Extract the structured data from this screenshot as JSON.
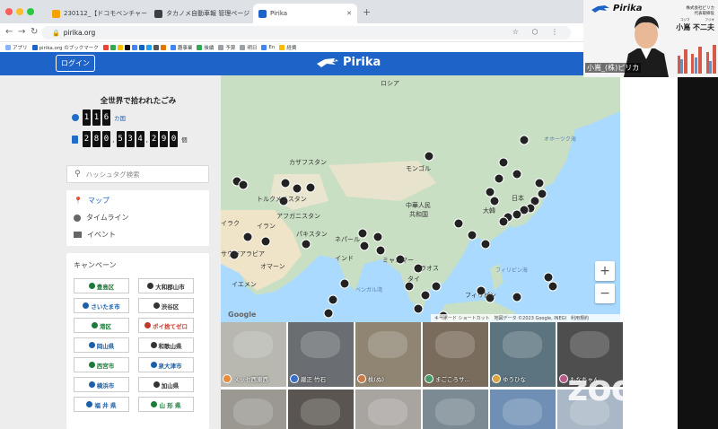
{
  "browser": {
    "tabs": [
      {
        "title": "230112_【ドコモベンチャーズピ",
        "color": "#f4a300"
      },
      {
        "title": "タカノメ自動車報 管理ページ",
        "color": "#3c4043"
      },
      {
        "title": "Pirika",
        "color": "#1e63c8"
      }
    ],
    "url": "pirika.org",
    "bookmarks": [
      "アプリ",
      "pirika.org のブックマーク",
      "趣事業",
      "後續",
      "予算",
      "明日",
      "En",
      "経費",
      "前回"
    ]
  },
  "header": {
    "login_label": "ログイン",
    "logo_text": "Pirika"
  },
  "stats": {
    "title": "全世界で拾われたごみ",
    "countries_digits": [
      "1",
      "1",
      "6"
    ],
    "countries_unit": "カ国",
    "trash_groups": [
      [
        "2",
        "8",
        "0"
      ],
      [
        "5",
        "3",
        "4"
      ],
      [
        "2",
        "9",
        "0"
      ]
    ],
    "trash_unit": "個"
  },
  "search": {
    "placeholder": "ハッシュタグ検索"
  },
  "nav": {
    "map": "マップ",
    "timeline": "タイムライン",
    "event": "イベント"
  },
  "campaign": {
    "title": "キャンペーン",
    "logos": [
      {
        "text": "豊島区",
        "color": "#1b7a3a"
      },
      {
        "text": "大和郡山市",
        "color": "#333"
      },
      {
        "text": "さいたま市",
        "color": "#1b5fa8"
      },
      {
        "text": "渋谷区",
        "color": "#333"
      },
      {
        "text": "港区",
        "color": "#1b7a3a"
      },
      {
        "text": "ポイ捨てゼロ",
        "color": "#c0392b"
      },
      {
        "text": "岡山県",
        "color": "#1b5fa8"
      },
      {
        "text": "和歌山県",
        "color": "#333"
      },
      {
        "text": "西宮市",
        "color": "#1b7a3a"
      },
      {
        "text": "泉大津市",
        "color": "#1b5fa8"
      },
      {
        "text": "横浜市",
        "color": "#1b5fa8"
      },
      {
        "text": "加山県",
        "color": "#333"
      },
      {
        "text": "福 井 県",
        "color": "#1b5fa8"
      },
      {
        "text": "山 形 県",
        "color": "#1b7a3a"
      }
    ]
  },
  "map": {
    "labels": [
      {
        "text": "ロシア"
      },
      {
        "text": "カザフスタン"
      },
      {
        "text": "モンゴル"
      },
      {
        "text": "トルクメニスタン"
      },
      {
        "text": "アフガニスタン"
      },
      {
        "text": "イラン"
      },
      {
        "text": "イラク"
      },
      {
        "text": "パキスタン"
      },
      {
        "text": "中華人民"
      },
      {
        "text": "共和国"
      },
      {
        "text": "大韓"
      },
      {
        "text": "日本"
      },
      {
        "text": "ネパール"
      },
      {
        "text": "インド"
      },
      {
        "text": "ミャンマー"
      },
      {
        "text": "タイ"
      },
      {
        "text": "ラオス"
      },
      {
        "text": "フィリピン"
      },
      {
        "text": "フィリピン海"
      },
      {
        "text": "オマーン"
      },
      {
        "text": "イエメン"
      },
      {
        "text": "サウジアラビア"
      },
      {
        "text": "ベンガル湾"
      },
      {
        "text": "オホーツク海"
      }
    ],
    "zoom_in": "+",
    "zoom_out": "−",
    "google": "Google",
    "attribution": [
      "キーボード ショートカット",
      "地図データ ©2023 Google, INEGI",
      "利用規約"
    ]
  },
  "photos": [
    {
      "user": "メッセ西東西",
      "bg": "#b8b8b0",
      "av": "#e88c3a"
    },
    {
      "user": "巌正 竹石",
      "bg": "#6a6e72",
      "av": "#3a6fc8"
    },
    {
      "user": "桃(ぬ)",
      "bg": "#8f8572",
      "av": "#c97b4a"
    },
    {
      "user": "まごころサ...",
      "bg": "#7a6c5c",
      "av": "#4a9a6a"
    },
    {
      "user": "ゆうひな",
      "bg": "#5c7480",
      "av": "#d9a441"
    },
    {
      "user": "もなちゃん",
      "bg": "#4e4e4e",
      "av": "#b85a8a"
    },
    {
      "user": "",
      "bg": "#9a9890",
      "av": ""
    },
    {
      "user": "",
      "bg": "#5a5550",
      "av": ""
    },
    {
      "user": "",
      "bg": "#a8a4a0",
      "av": ""
    },
    {
      "user": "",
      "bg": "#7c8a94",
      "av": ""
    },
    {
      "user": "",
      "bg": "#6f8fb5",
      "av": ""
    },
    {
      "user": "",
      "bg": "#a9b7c6",
      "av": ""
    }
  ],
  "video": {
    "name": "小嶌_(株)ピリカ",
    "brand": "Pirika",
    "company": "株式会社ピリカ",
    "role": "代表取締役",
    "person": "小嶌 不二夫",
    "ruby_left": "コジマ",
    "ruby_right": "フジオ"
  },
  "zoom_watermark": "zoom"
}
